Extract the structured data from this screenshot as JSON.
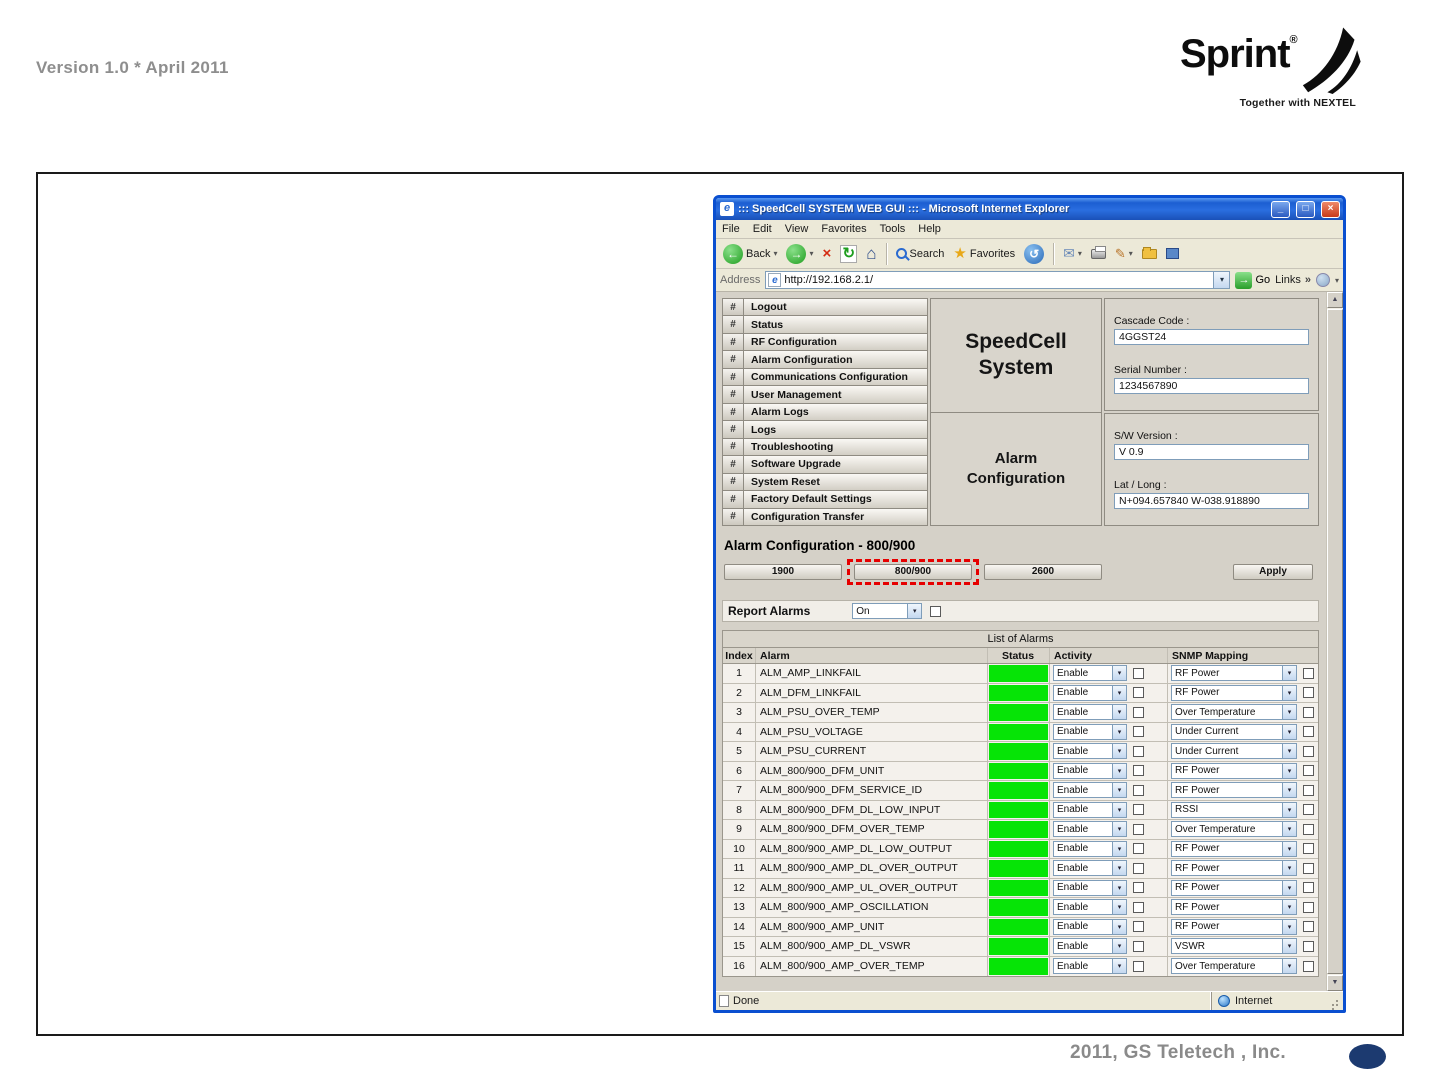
{
  "page": {
    "version_text": "Version 1.0 * April 2011",
    "footer_text": "2011, GS Teletech , Inc."
  },
  "logo": {
    "brand": "Sprint",
    "trademark": "®",
    "tagline": "Together with NEXTEL"
  },
  "colors": {
    "status_ok_green": "#06e406",
    "highlight_red": "#e60000",
    "titlebar_blue": "#2a6ee0",
    "footer_ellipse_navy": "#1c3a70"
  },
  "icons": {
    "ie_logo": "e",
    "minimize": "_",
    "maximize": "□",
    "close": "×",
    "back_arrow": "←",
    "forward_arrow": "→",
    "stop": "×",
    "refresh": "↻",
    "home": "⌂",
    "history": "↺",
    "mail": "✉",
    "edit": "✎",
    "star": "★",
    "dropdown": "▾",
    "go_arrow": "→",
    "chevron": "»",
    "scroll_up": "▲",
    "scroll_down": "▼"
  },
  "browser": {
    "window_title": "::: SpeedCell SYSTEM WEB GUI ::: - Microsoft Internet Explorer",
    "menu_items": [
      "File",
      "Edit",
      "View",
      "Favorites",
      "Tools",
      "Help"
    ],
    "toolbar": {
      "back_label": "Back",
      "search_label": "Search",
      "favorites_label": "Favorites"
    },
    "address": {
      "label": "Address",
      "value": "http://192.168.2.1/",
      "go_label": "Go",
      "links_label": "Links"
    },
    "status": {
      "left": "Done",
      "right": "Internet"
    }
  },
  "app": {
    "nav_hash": "#",
    "nav_items": [
      "Logout",
      "Status",
      "RF Configuration",
      "Alarm Configuration",
      "Communications Configuration",
      "User Management",
      "Alarm Logs",
      "Logs",
      "Troubleshooting",
      "Software Upgrade",
      "System Reset",
      "Factory Default Settings",
      "Configuration Transfer"
    ],
    "system_title_line1": "SpeedCell",
    "system_title_line2": "System",
    "page_title_line1": "Alarm",
    "page_title_line2": "Configuration",
    "info_fields": [
      {
        "label": "Cascade Code :",
        "value": "4GGST24"
      },
      {
        "label": "Serial Number :",
        "value": "1234567890"
      },
      {
        "label": "S/W Version :",
        "value": "V 0.9"
      },
      {
        "label": "Lat / Long :",
        "value": "N+094.657840 W-038.918890"
      }
    ],
    "section_title": "Alarm Configuration - 800/900",
    "bands": [
      "1900",
      "800/900",
      "2600"
    ],
    "apply_label": "Apply",
    "report_alarms": {
      "label": "Report Alarms",
      "value": "On"
    },
    "alarm_table": {
      "title": "List of Alarms",
      "headers": [
        "Index",
        "Alarm",
        "Status",
        "Activity",
        "SNMP Mapping"
      ],
      "rows": [
        {
          "index": "1",
          "alarm": "ALM_AMP_LINKFAIL",
          "activity": "Enable",
          "snmp": "RF Power"
        },
        {
          "index": "2",
          "alarm": "ALM_DFM_LINKFAIL",
          "activity": "Enable",
          "snmp": "RF Power"
        },
        {
          "index": "3",
          "alarm": "ALM_PSU_OVER_TEMP",
          "activity": "Enable",
          "snmp": "Over Temperature"
        },
        {
          "index": "4",
          "alarm": "ALM_PSU_VOLTAGE",
          "activity": "Enable",
          "snmp": "Under Current"
        },
        {
          "index": "5",
          "alarm": "ALM_PSU_CURRENT",
          "activity": "Enable",
          "snmp": "Under Current"
        },
        {
          "index": "6",
          "alarm": "ALM_800/900_DFM_UNIT",
          "activity": "Enable",
          "snmp": "RF Power"
        },
        {
          "index": "7",
          "alarm": "ALM_800/900_DFM_SERVICE_ID",
          "activity": "Enable",
          "snmp": "RF Power"
        },
        {
          "index": "8",
          "alarm": "ALM_800/900_DFM_DL_LOW_INPUT",
          "activity": "Enable",
          "snmp": "RSSI"
        },
        {
          "index": "9",
          "alarm": "ALM_800/900_DFM_OVER_TEMP",
          "activity": "Enable",
          "snmp": "Over Temperature"
        },
        {
          "index": "10",
          "alarm": "ALM_800/900_AMP_DL_LOW_OUTPUT",
          "activity": "Enable",
          "snmp": "RF Power"
        },
        {
          "index": "11",
          "alarm": "ALM_800/900_AMP_DL_OVER_OUTPUT",
          "activity": "Enable",
          "snmp": "RF Power"
        },
        {
          "index": "12",
          "alarm": "ALM_800/900_AMP_UL_OVER_OUTPUT",
          "activity": "Enable",
          "snmp": "RF Power"
        },
        {
          "index": "13",
          "alarm": "ALM_800/900_AMP_OSCILLATION",
          "activity": "Enable",
          "snmp": "RF Power"
        },
        {
          "index": "14",
          "alarm": "ALM_800/900_AMP_UNIT",
          "activity": "Enable",
          "snmp": "RF Power"
        },
        {
          "index": "15",
          "alarm": "ALM_800/900_AMP_DL_VSWR",
          "activity": "Enable",
          "snmp": "VSWR"
        },
        {
          "index": "16",
          "alarm": "ALM_800/900_AMP_OVER_TEMP",
          "activity": "Enable",
          "snmp": "Over Temperature"
        }
      ]
    }
  }
}
